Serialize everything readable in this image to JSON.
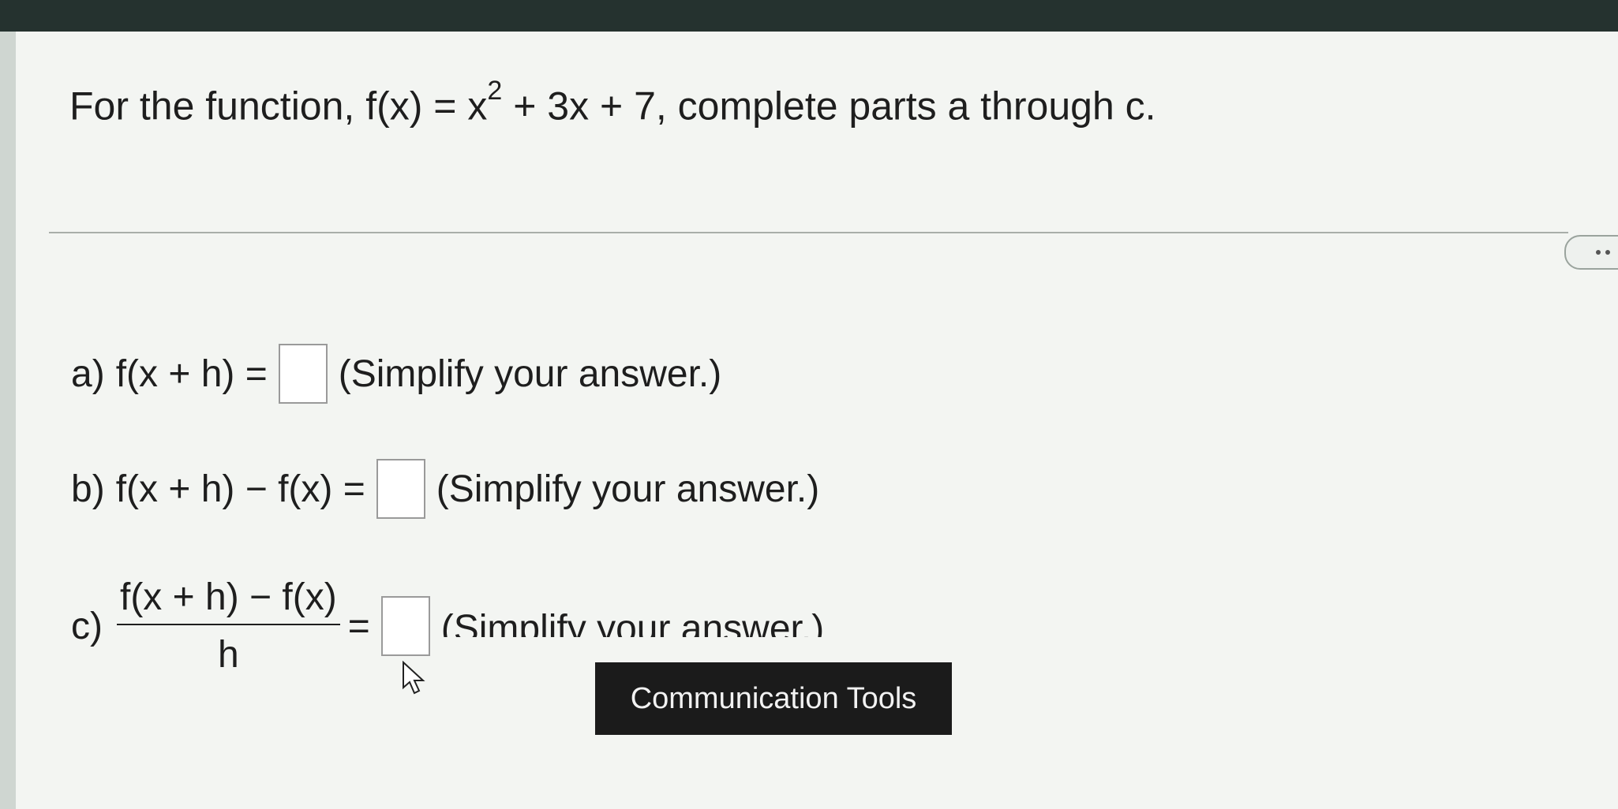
{
  "question": {
    "prefix": "For the function, f(x) = x",
    "exponent": "2",
    "suffix": " + 3x + 7, complete parts a through c."
  },
  "parts": {
    "a": {
      "label": "a)",
      "expression": "f(x + h) =",
      "hint": "(Simplify your answer.)"
    },
    "b": {
      "label": "b)",
      "expression": "f(x + h) − f(x) =",
      "hint": "(Simplify your answer.)"
    },
    "c": {
      "label": "c)",
      "numerator": "f(x + h) − f(x)",
      "denominator": "h",
      "equals": "=",
      "hint": "(Simplify your answer.)"
    }
  },
  "tooltip": {
    "text": "Communication Tools"
  },
  "icons": {
    "more": "more-options-icon",
    "cursor": "mouse-pointer-icon"
  }
}
